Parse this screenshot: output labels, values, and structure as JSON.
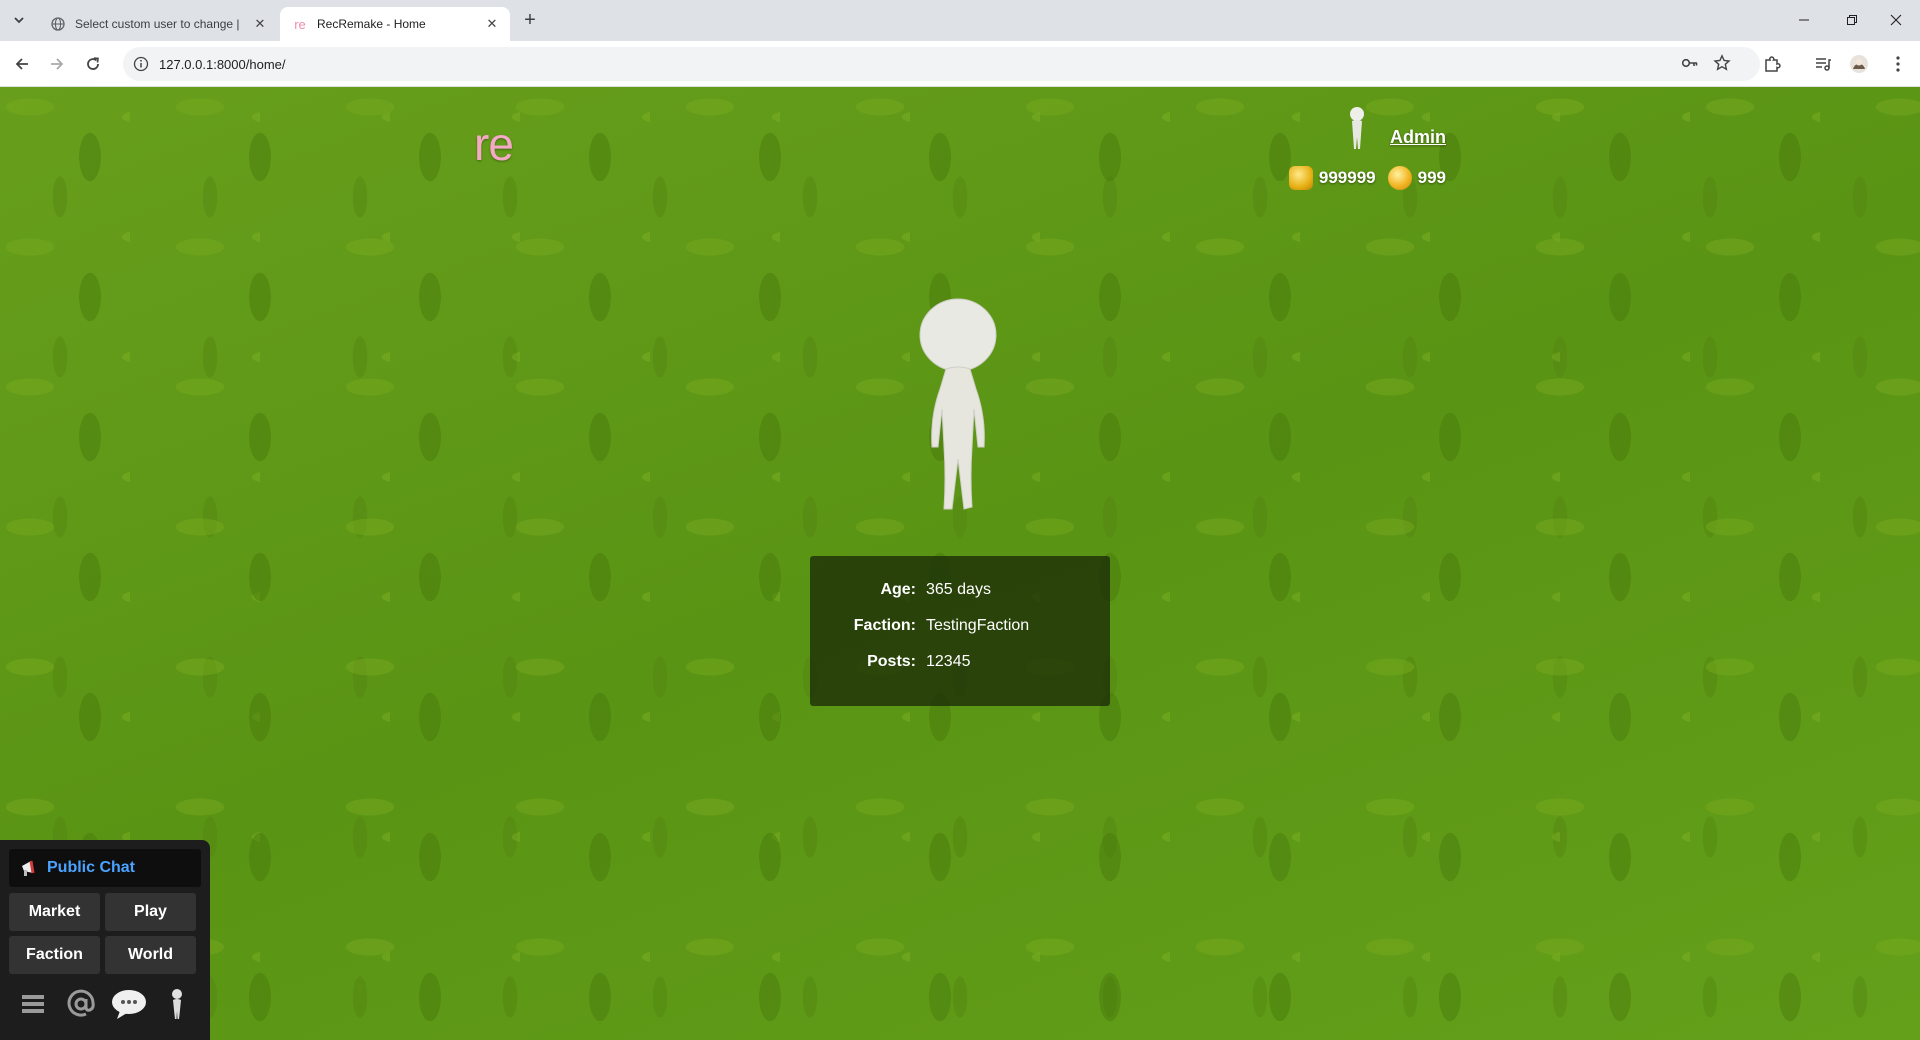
{
  "browser": {
    "tabs": [
      {
        "title": "Select custom user to change |",
        "active": false
      },
      {
        "title": "RecRemake - Home",
        "favicon_text": "re",
        "active": true
      }
    ],
    "url": "127.0.0.1:8000/home/"
  },
  "page": {
    "logo": "re",
    "user": {
      "name": "Admin"
    },
    "currency": {
      "coins": "999999",
      "gems": "999"
    },
    "stats": [
      {
        "label": "Age:",
        "value": "365 days"
      },
      {
        "label": "Faction:",
        "value": "TestingFaction"
      },
      {
        "label": "Posts:",
        "value": "12345"
      }
    ],
    "dock": {
      "chat_label": "Public Chat",
      "buttons": [
        "Market",
        "Play",
        "Faction",
        "World"
      ]
    }
  },
  "colors": {
    "grass": "#5f9a16",
    "logo_pink": "#f4a9c4",
    "chat_blue": "#4aa3ff",
    "panel_dark": "#1d1d1d"
  }
}
